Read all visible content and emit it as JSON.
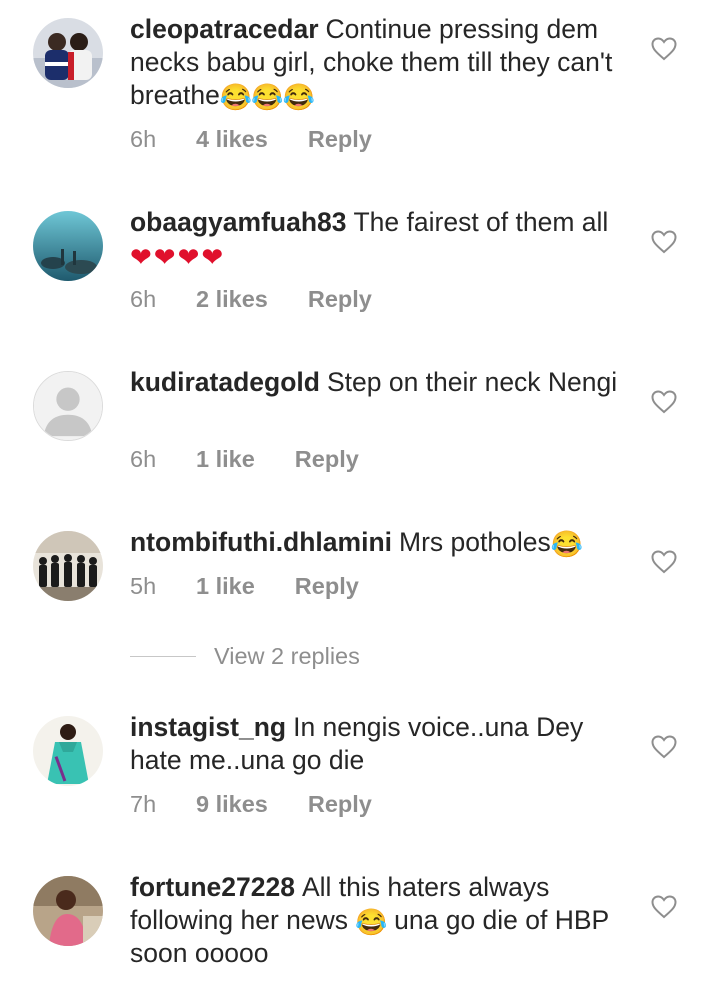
{
  "comments": [
    {
      "username": "cleopatracedar",
      "text": "Continue pressing dem necks babu girl, choke them till they can't breathe",
      "emoji": "😂😂😂",
      "time": "6h",
      "likes": "4 likes",
      "reply": "Reply"
    },
    {
      "username": "obaagyamfuah83",
      "text": "The fairest of them all",
      "emoji": "❤❤❤❤",
      "time": "6h",
      "likes": "2 likes",
      "reply": "Reply"
    },
    {
      "username": "kudiratadegold",
      "text": "Step on their neck Nengi",
      "time": "6h",
      "likes": "1 like",
      "reply": "Reply"
    },
    {
      "username": "ntombifuthi.dhlamini",
      "text": "Mrs potholes",
      "emoji": "😂",
      "time": "5h",
      "likes": "1 like",
      "reply": "Reply"
    },
    {
      "username": "instagist_ng",
      "text": "In nengis voice..una Dey hate me..una go die",
      "time": "7h",
      "likes": "9 likes",
      "reply": "Reply"
    },
    {
      "username": "fortune27228",
      "text_before": "All this haters always following her news",
      "emoji": "😂",
      "text_after": "una go die of HBP soon ooooo"
    }
  ],
  "view_replies": "View 2 replies",
  "icons": {
    "like": "heart-outline-icon",
    "avatar_placeholder": "default-avatar-icon"
  },
  "colors": {
    "text": "#262626",
    "secondary": "#8e8e8e",
    "heart_emoji": "#e0102c"
  }
}
